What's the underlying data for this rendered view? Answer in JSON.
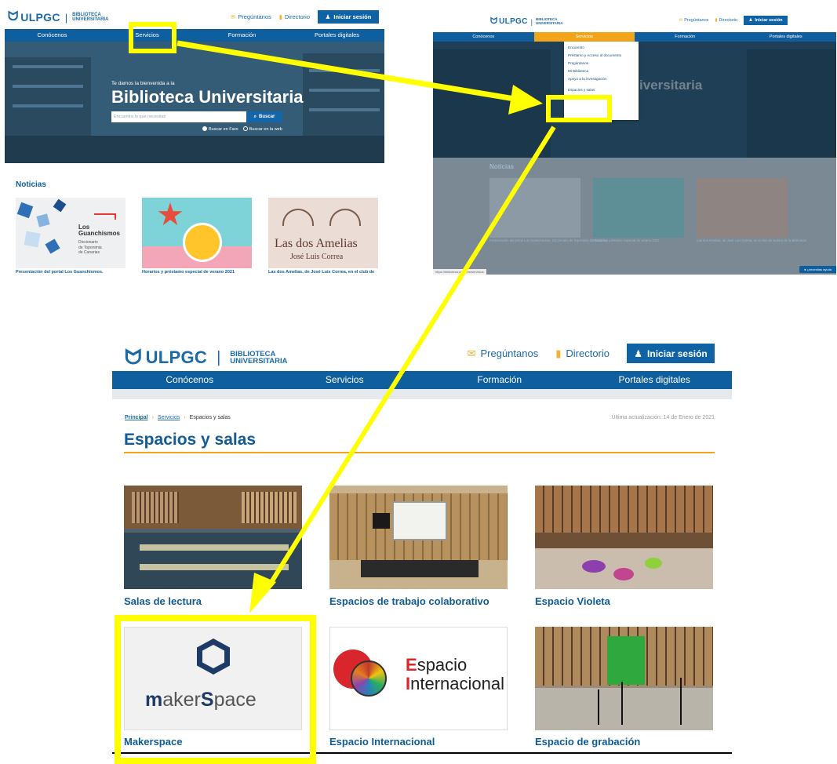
{
  "colors": {
    "brand": "#0f5f9e",
    "accent": "#f3a41a",
    "highlight": "#ffff00"
  },
  "header": {
    "logo_text": "ULPGC",
    "logo_sep": "|",
    "logo_sub1": "BIBLIOTECA",
    "logo_sub2": "UNIVERSITARIA",
    "ask_label": "Pregúntanos",
    "directory_label": "Directorio",
    "login_label": "Iniciar sesión"
  },
  "nav": [
    "Conócenos",
    "Servicios",
    "Formación",
    "Portales digitales"
  ],
  "home": {
    "hero_kicker": "Te damos la bienvenida a la",
    "hero_title": "Biblioteca Universitaria",
    "search_placeholder": "Encuentra lo que necesitas",
    "search_button": "Buscar",
    "radio_faro": "Buscar en Faro",
    "radio_web": "Buscar en la web",
    "news_heading": "Noticias",
    "news": [
      {
        "caption": "Presentación del portal Los Guanchismos.",
        "image_title": "Los Guanchismos",
        "image_sub1": "Diccionario",
        "image_sub2": "de Toponimia",
        "image_sub3": "de Canarias"
      },
      {
        "caption": "Horarios y préstamo especial de verano 2021"
      },
      {
        "caption": "Las dos Amelias, de José Luis Correa, en el club de",
        "image_title": "Las dos Amelias",
        "image_author": "José Luis Correa"
      }
    ]
  },
  "menu_open": {
    "hero_title_partial": "iversitaria",
    "dropdown_items": [
      "Encuentro",
      "Préstamo y Acceso al documento",
      "Pregúntanos",
      "Mi Biblioteca",
      "Apoyo a la investigación",
      "Espacios y salas"
    ],
    "news": [
      "Presentación del portal Los Guanchismos. Diccionario de Toponimia de Canarias",
      "Horarios y préstamo especial de verano 2021",
      "Las dos Amelias, de José Luis Correa, en el club de lectura de la Biblioteca"
    ],
    "status_url": "https://biblioteca.ulpgc.es/servicios",
    "chat_label": "¿necesitas ayuda"
  },
  "spaces_page": {
    "breadcrumb": [
      "Principal",
      "Servicios",
      "Espacios y salas"
    ],
    "updated": "Última actualización: 14 de Enero de 2021",
    "title": "Espacios y salas",
    "tiles": [
      "Salas de lectura",
      "Espacios de trabajo colaborativo",
      "Espacio Violeta",
      "Makerspace",
      "Espacio Internacional",
      "Espacio de grabación"
    ],
    "makerspace_logo_a": "m",
    "makerspace_logo_b": "aker",
    "makerspace_logo_c": "S",
    "makerspace_logo_d": "pace",
    "internacional_logo_a": "E",
    "internacional_logo_b": "spacio",
    "internacional_logo_c": "I",
    "internacional_logo_d": "nternacional"
  }
}
